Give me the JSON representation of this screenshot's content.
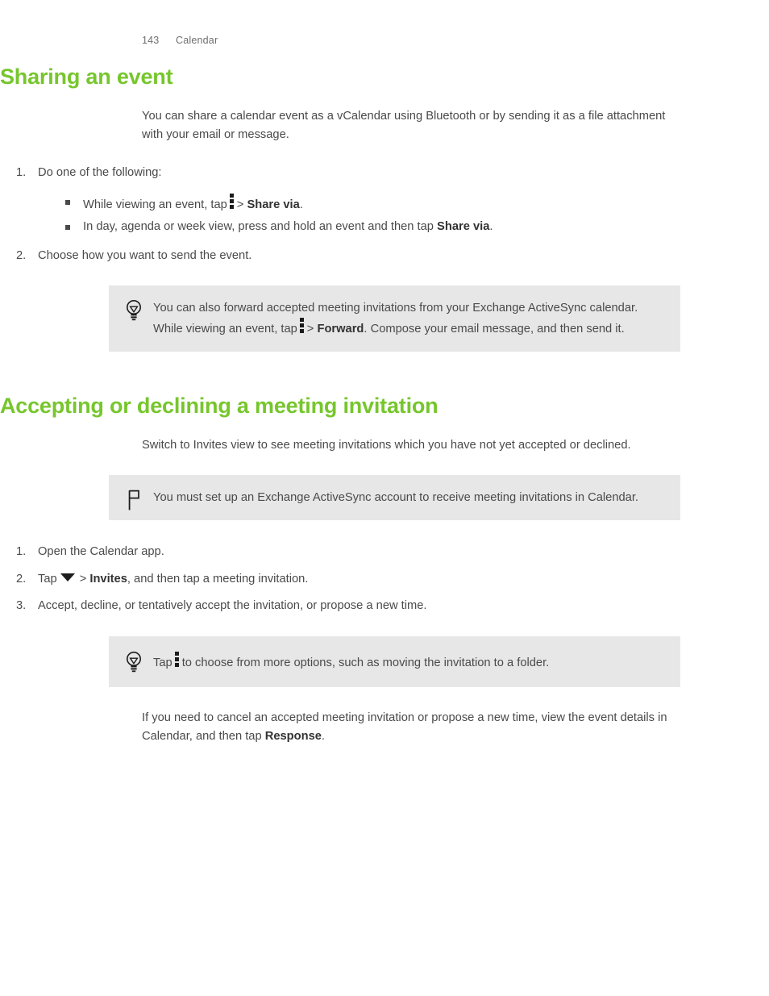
{
  "header": {
    "page_number": "143",
    "chapter": "Calendar"
  },
  "colors": {
    "heading_green": "#76c62c",
    "body_text": "#4a4a4a",
    "callout_background": "#e7e7e7"
  },
  "sections": [
    {
      "title": "Sharing an event",
      "intro": "You can share a calendar event as a vCalendar using Bluetooth or by sending it as a file attachment with your email or message.",
      "steps": [
        {
          "num": "1.",
          "text": "Do one of the following:",
          "sub_items": [
            {
              "before": "While viewing an event, tap",
              "icon": "overflow-menu-icon",
              "separator": ">",
              "bold": "Share via",
              "after": "."
            },
            {
              "before": "In day, agenda or week view, press and hold an event and then tap",
              "bold": "Share via",
              "after": "."
            }
          ]
        },
        {
          "num": "2.",
          "text": "Choose how you want to send the event."
        }
      ],
      "tip": {
        "icon": "lightbulb-icon",
        "part1": "You can also forward accepted meeting invitations from your Exchange ActiveSync calendar. While viewing an event, tap",
        "icon_inline": "overflow-menu-icon",
        "separator": ">",
        "bold": "Forward",
        "part2": ". Compose your email message, and then send it."
      }
    },
    {
      "title": "Accepting or declining a meeting invitation",
      "intro": "Switch to Invites view to see meeting invitations which you have not yet accepted or declined.",
      "note": {
        "icon": "flag-icon",
        "text": "You must set up an Exchange ActiveSync account to receive meeting invitations in Calendar."
      },
      "steps": [
        {
          "num": "1.",
          "text": "Open the Calendar app."
        },
        {
          "num": "2.",
          "before": "Tap",
          "icon": "caret-down-icon",
          "separator": ">",
          "bold": "Invites",
          "after": ", and then tap a meeting invitation."
        },
        {
          "num": "3.",
          "text": "Accept, decline, or tentatively accept the invitation, or propose a new time."
        }
      ],
      "tip": {
        "icon": "lightbulb-icon",
        "before": "Tap",
        "icon_inline": "overflow-menu-icon",
        "after": "to choose from more options, such as moving the invitation to a folder."
      },
      "closing": {
        "part1": "If you need to cancel an accepted meeting invitation or propose a new time, view the event details in Calendar, and then tap",
        "bold": "Response",
        "part2": "."
      }
    }
  ]
}
